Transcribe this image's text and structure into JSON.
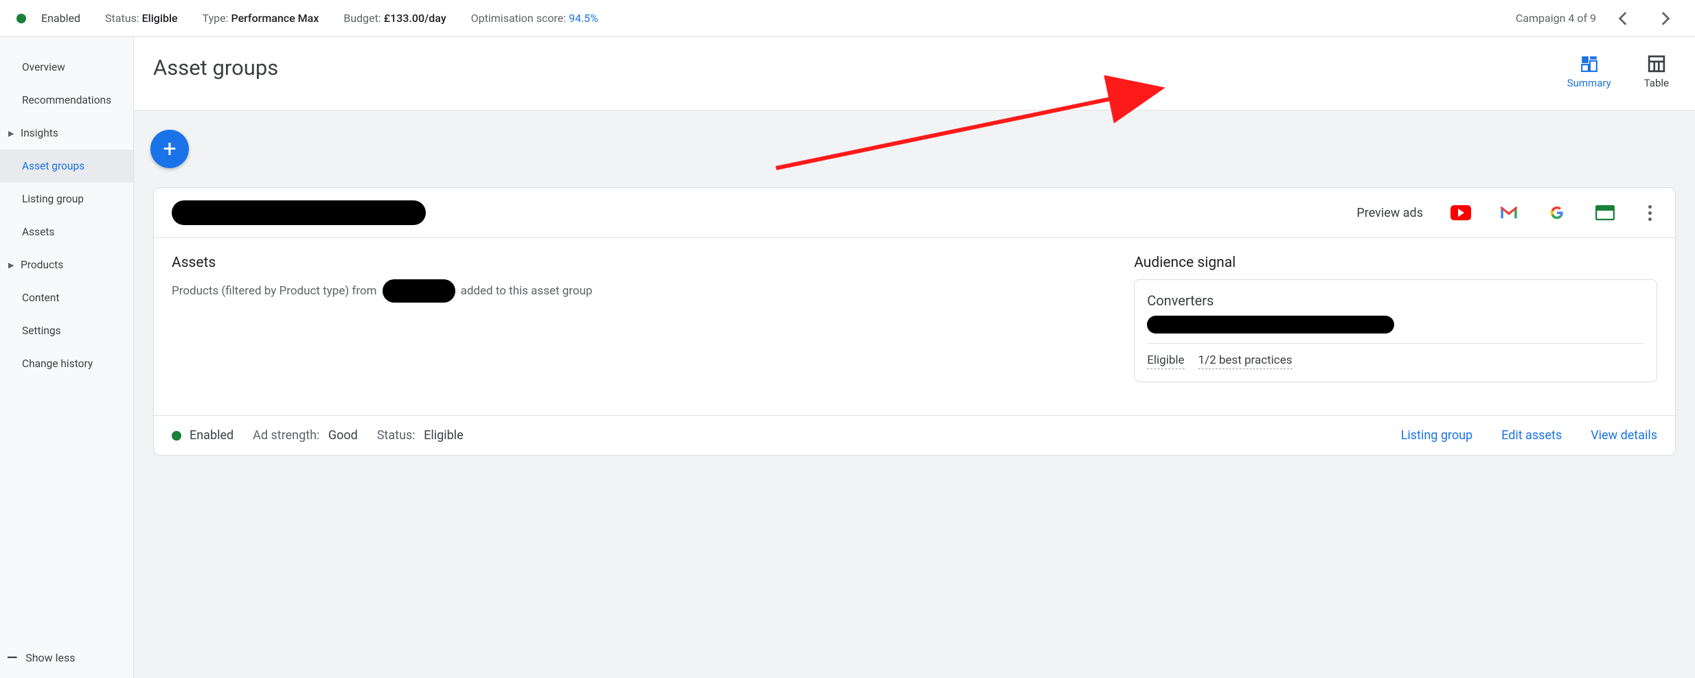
{
  "topbar": {
    "enabled_label": "Enabled",
    "status_label": "Status:",
    "status_value": "Eligible",
    "type_label": "Type:",
    "type_value": "Performance Max",
    "budget_label": "Budget:",
    "budget_value": "£133.00/day",
    "opt_label": "Optimisation score:",
    "opt_value": "94.5%",
    "campaign_nav": "Campaign 4 of 9"
  },
  "sidebar": {
    "items": [
      {
        "label": "Overview",
        "expandable": false,
        "active": false
      },
      {
        "label": "Recommendations",
        "expandable": false,
        "active": false
      },
      {
        "label": "Insights",
        "expandable": true,
        "active": false
      },
      {
        "label": "Asset groups",
        "expandable": false,
        "active": true
      },
      {
        "label": "Listing group",
        "expandable": false,
        "active": false
      },
      {
        "label": "Assets",
        "expandable": false,
        "active": false
      },
      {
        "label": "Products",
        "expandable": true,
        "active": false
      },
      {
        "label": "Content",
        "expandable": false,
        "active": false
      },
      {
        "label": "Settings",
        "expandable": false,
        "active": false
      },
      {
        "label": "Change history",
        "expandable": false,
        "active": false
      }
    ],
    "show_less": "Show less"
  },
  "page": {
    "title": "Asset groups",
    "view_summary": "Summary",
    "view_table": "Table"
  },
  "card": {
    "preview_label": "Preview ads",
    "assets_title": "Assets",
    "assets_sub_pre": "Products (filtered by Product type) from",
    "assets_sub_post": "added to this asset group",
    "audience_title": "Audience signal",
    "converters_title": "Converters",
    "eligible_link": "Eligible",
    "best_practices_link": "1/2 best practices",
    "footer_enabled": "Enabled",
    "ad_strength_label": "Ad strength:",
    "ad_strength_value": "Good",
    "footer_status_label": "Status:",
    "footer_status_value": "Eligible",
    "listing_group_link": "Listing group",
    "edit_assets_link": "Edit assets",
    "view_details_link": "View details"
  }
}
